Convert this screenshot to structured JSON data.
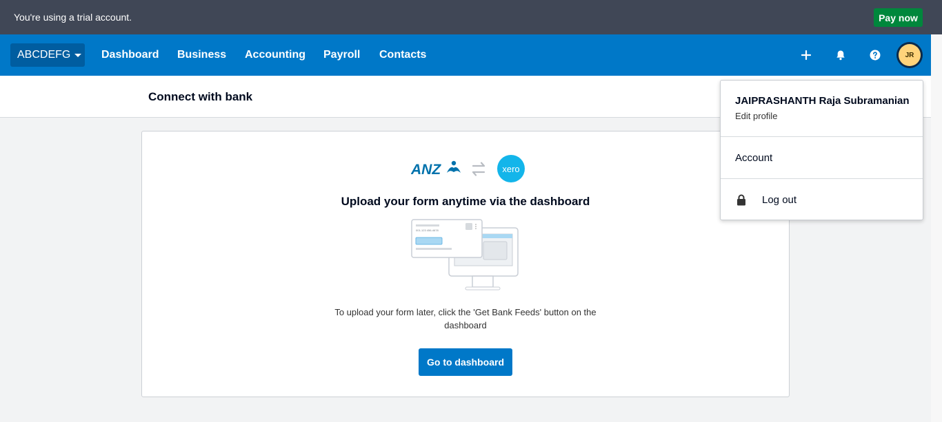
{
  "trial_bar": {
    "message": "You're using a trial account.",
    "pay_now_label": "Pay now"
  },
  "nav": {
    "org_name": "ABCDEFG",
    "items": [
      "Dashboard",
      "Business",
      "Accounting",
      "Payroll",
      "Contacts"
    ],
    "icons": [
      "plus-icon",
      "bell-icon",
      "help-icon"
    ],
    "avatar_initials": "JR"
  },
  "page": {
    "title": "Connect with bank"
  },
  "card": {
    "bank_logo_text": "ANZ",
    "partner_logo_text": "xero",
    "heading": "Upload your form anytime via the dashboard",
    "form_number": "001-123 456-4678",
    "info": "To upload your form later, click the 'Get Bank Feeds' button on the dashboard",
    "button_label": "Go to dashboard"
  },
  "user_menu": {
    "name": "JAIPRASHANTH Raja Subramanian",
    "edit_profile": "Edit profile",
    "account": "Account",
    "logout": "Log out"
  },
  "colors": {
    "trial_bar": "#404756",
    "nav": "#0078c8",
    "pay_now": "#00873c",
    "avatar": "#ffd47b",
    "anz_blue": "#0072ac",
    "xero_blue": "#13b5ea"
  }
}
